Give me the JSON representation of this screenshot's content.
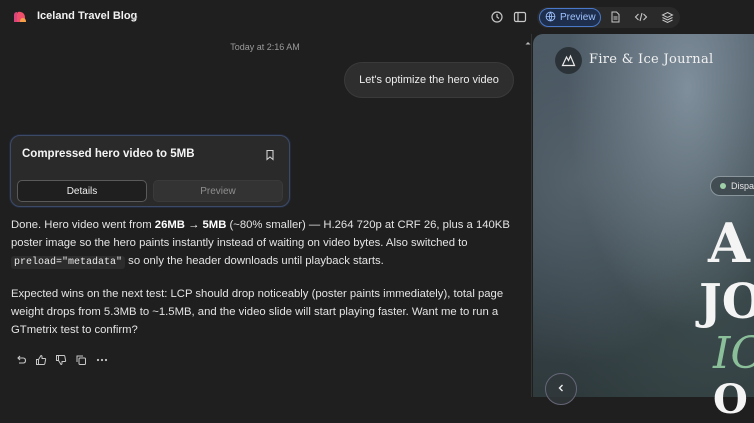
{
  "header": {
    "title": "Iceland Travel Blog",
    "preview_label": "Preview",
    "icons": [
      "history-icon",
      "sidebar-toggle-icon",
      "globe-icon",
      "file-icon",
      "code-icon",
      "layers-icon"
    ]
  },
  "chat": {
    "timestamp": "Today at 2:16 AM",
    "user_message": "Let's optimize the hero video",
    "card": {
      "title": "Compressed hero video to 5MB",
      "tab_details": "Details",
      "tab_preview": "Preview"
    },
    "response": {
      "p1_a": "Done. Hero video went from ",
      "p1_b": "26MB → 5MB",
      "p1_c": " (~80% smaller) — H.264 720p at CRF 26, plus a 140KB poster image so the hero paints instantly instead of waiting on video bytes. Also switched to ",
      "p1_code": "preload=\"metadata\"",
      "p1_d": " so only the header downloads until playback starts.",
      "p2": "Expected wins on the next test: LCP should drop noticeably (poster paints immediately), total page weight drops from 5.3MB to ~1.5MB, and the video slide will start playing faster. Want me to run a GTmetrix test to confirm?"
    },
    "actions": [
      "undo-icon",
      "thumbs-up-icon",
      "thumbs-down-icon",
      "copy-icon",
      "more-icon"
    ]
  },
  "preview": {
    "brand": "Fire & Ice Journal",
    "pill_text": "Dispa",
    "hero_line1": "A",
    "hero_line2": "JO",
    "hero_line3": "IC",
    "hero_line4": "O",
    "accent": "#8bbf9a"
  },
  "colors": {
    "background": "#1f1f1f",
    "accent_blue": "#4a78c8"
  }
}
